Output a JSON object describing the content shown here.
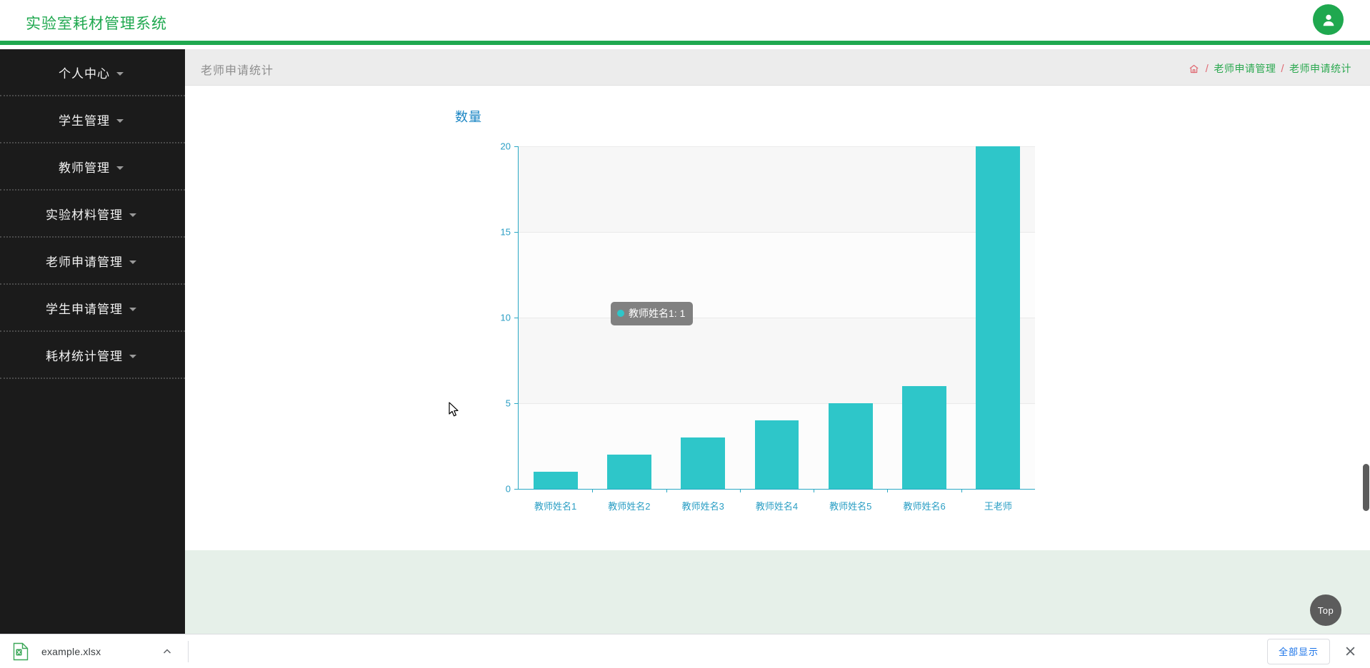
{
  "header": {
    "brand": "实验室耗材管理系统",
    "avatar_icon": "user-avatar-icon"
  },
  "sidebar": {
    "items": [
      {
        "label": "个人中心"
      },
      {
        "label": "学生管理"
      },
      {
        "label": "教师管理"
      },
      {
        "label": "实验材料管理"
      },
      {
        "label": "老师申请管理"
      },
      {
        "label": "学生申请管理"
      },
      {
        "label": "耗材统计管理"
      }
    ]
  },
  "breadcrumb": {
    "page_title": "老师申请统计",
    "home_icon": "home-icon",
    "separator": "/",
    "parent": "老师申请管理",
    "current": "老师申请统计"
  },
  "chart_data": {
    "type": "bar",
    "title": "数量",
    "xlabel": "",
    "ylabel": "",
    "categories": [
      "教师姓名1",
      "教师姓名2",
      "教师姓名3",
      "教师姓名4",
      "教师姓名5",
      "教师姓名6",
      "王老师"
    ],
    "values": [
      1,
      2,
      3,
      4,
      5,
      6,
      20
    ],
    "series": [
      {
        "name": "数量",
        "values": [
          1,
          2,
          3,
          4,
          5,
          6,
          20
        ]
      }
    ],
    "ylim": [
      0,
      20
    ],
    "yticks": [
      0,
      5,
      10,
      15,
      20
    ],
    "ytick_labels": [
      "0",
      "5",
      "10",
      "15",
      "20"
    ],
    "grid": true,
    "legend": "none",
    "bar_color": "#2ec6c9",
    "axis_color": "#2aa8c4",
    "title_color": "#1b86c4"
  },
  "tooltip": {
    "visible": true,
    "series_marker": "legend-dot",
    "text": "教师姓名1: 1"
  },
  "to_top": {
    "label": "Top"
  },
  "download_shelf": {
    "file_icon": "xlsx-file-icon",
    "file_name": "example.xlsx",
    "caret_icon": "chevron-up-icon",
    "show_all_label": "全部显示",
    "close_icon": "close-icon"
  }
}
